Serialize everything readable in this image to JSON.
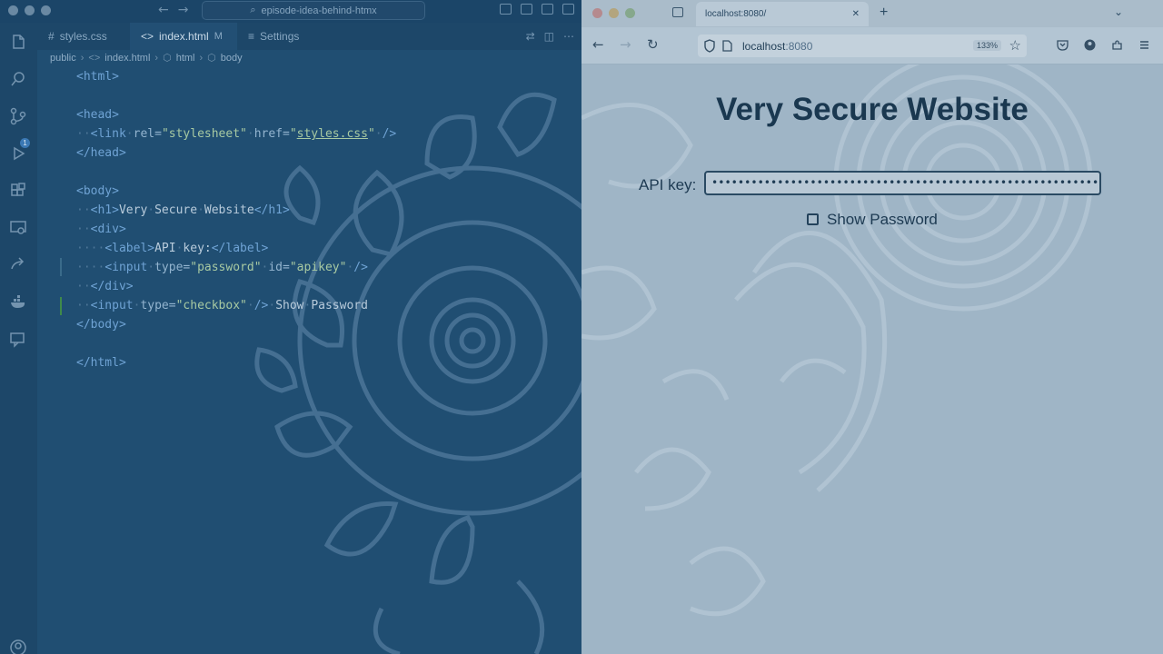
{
  "editor": {
    "search_text": "episode-idea-behind-htmx",
    "tabs": [
      {
        "label": "styles.css",
        "icon": "#",
        "modified": ""
      },
      {
        "label": "index.html",
        "icon": "<>",
        "modified": "M"
      },
      {
        "label": "Settings",
        "icon": "≡",
        "modified": ""
      }
    ],
    "breadcrumb": [
      "public",
      "index.html",
      "html",
      "body"
    ],
    "scm_badge": "1"
  },
  "browser": {
    "tab_title": "localhost:8080/",
    "url_host": "localhost",
    "url_port": ":8080",
    "zoom": "133%"
  },
  "page": {
    "heading": "Very Secure Website",
    "api_label": "API key:",
    "password_mask": "••••••••••••••••••••••••••••••••••••••••••••••••••••••••••••",
    "checkbox_label": "Show Password"
  },
  "colors": {
    "editor_bg": "#204e72",
    "browser_bg": "#9fb5c6",
    "heading": "#1a3850"
  }
}
